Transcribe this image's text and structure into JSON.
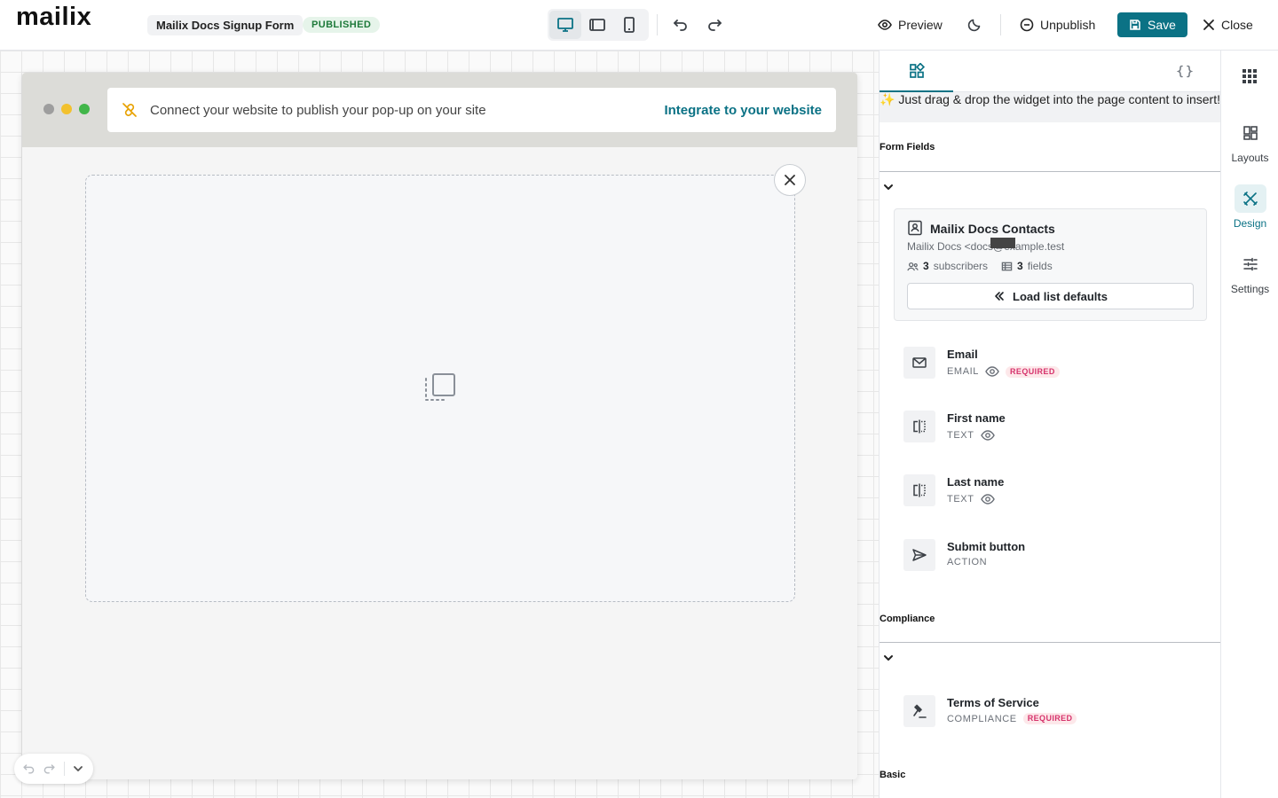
{
  "app": {
    "logo": "mailix"
  },
  "header": {
    "form_name": "Mailix Docs Signup Form",
    "status": "PUBLISHED",
    "devices": [
      "desktop-icon",
      "tablet-icon",
      "mobile-icon"
    ],
    "active_device": "desktop",
    "preview_label": "Preview",
    "unpublish_label": "Unpublish",
    "save_label": "Save",
    "close_label": "Close"
  },
  "canvas": {
    "banner_text": "Connect your website to publish your pop-up on your site",
    "banner_link": "Integrate to your website"
  },
  "panel": {
    "hint": "✨ Just drag & drop the widget into the page content to insert!",
    "form_fields_title": "Form Fields",
    "list": {
      "name": "Mailix Docs Contacts",
      "sender": "Mailix Docs <docs@example.test",
      "subscribers_count": "3",
      "subscribers_label": "subscribers",
      "fields_count": "3",
      "fields_label": "fields",
      "load_button": "Load list defaults"
    },
    "fields": [
      {
        "name": "Email",
        "type": "EMAIL",
        "visible": true,
        "required": true,
        "icon": "mail-icon"
      },
      {
        "name": "First name",
        "type": "TEXT",
        "visible": true,
        "required": false,
        "icon": "text-field-icon"
      },
      {
        "name": "Last name",
        "type": "TEXT",
        "visible": true,
        "required": false,
        "icon": "text-field-icon"
      },
      {
        "name": "Submit button",
        "type": "ACTION",
        "visible": false,
        "required": false,
        "icon": "send-icon"
      }
    ],
    "compliance_title": "Compliance",
    "compliance_fields": [
      {
        "name": "Terms of Service",
        "type": "COMPLIANCE",
        "required": true,
        "icon": "gavel-icon"
      }
    ],
    "basic_title": "Basic",
    "required_label": "REQUIRED"
  },
  "rail": {
    "items": [
      {
        "label": "Layouts",
        "icon": "layouts-icon"
      },
      {
        "label": "Design",
        "icon": "design-icon",
        "active": true
      },
      {
        "label": "Settings",
        "icon": "sliders-icon"
      }
    ]
  },
  "colors": {
    "accent": "#0b7285",
    "published": "#1e7a3a",
    "required": "#d6336c"
  }
}
